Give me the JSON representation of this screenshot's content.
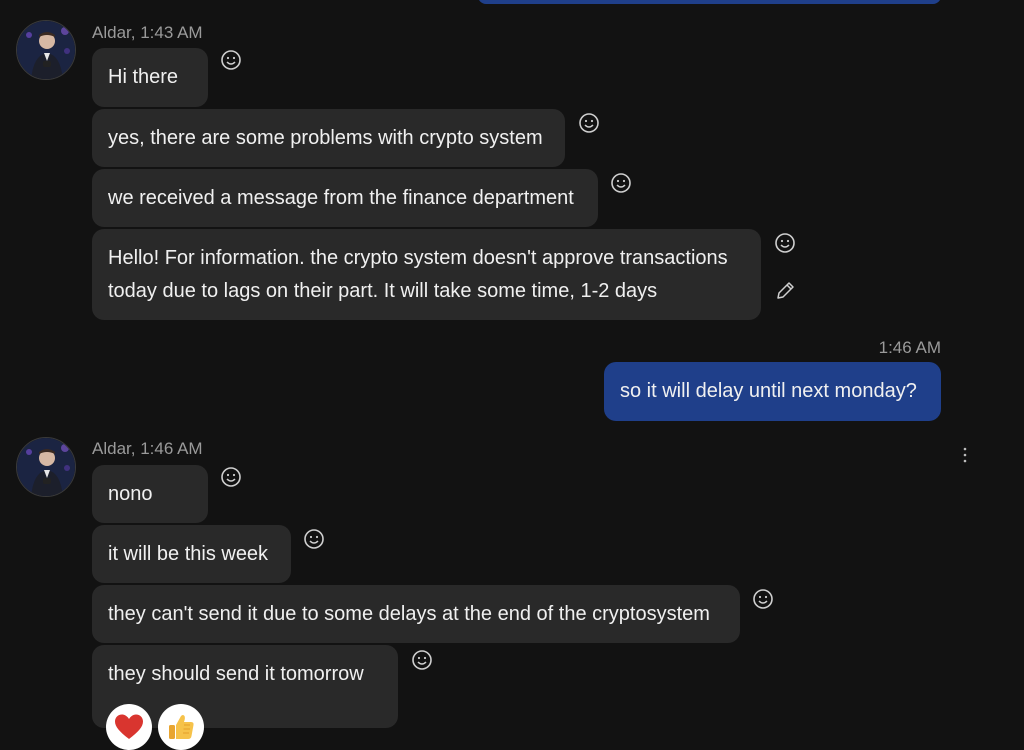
{
  "conversation": {
    "first_group": {
      "sender": "Aldar, 1:43 AM",
      "messages": [
        "Hi there",
        "yes, there are some problems with crypto system",
        "we received a message from the finance department",
        "Hello! For information. the crypto system doesn't approve transactions",
        "today due to lags on their part. It will take some time, 1-2 days"
      ]
    },
    "outgoing": {
      "time": "1:46 AM",
      "text": "so it will delay until next monday?"
    },
    "second_group": {
      "sender": "Aldar, 1:46 AM",
      "messages": [
        "nono",
        "it will be this week",
        "they can't send it due to some delays at the end of the cryptosystem",
        "they should send it tomorrow"
      ]
    },
    "reactions": [
      "heart",
      "thumbs-up"
    ]
  },
  "colors": {
    "background": "#121212",
    "incoming_bubble": "#292929",
    "outgoing_bubble": "#1f3f8a",
    "meta_text": "#9a9a9a"
  }
}
